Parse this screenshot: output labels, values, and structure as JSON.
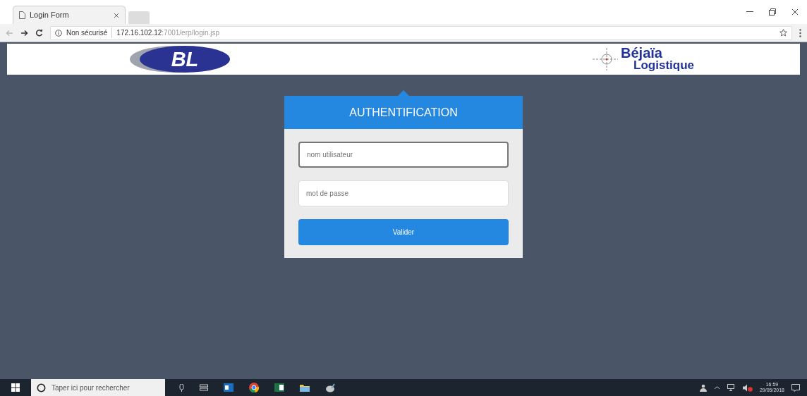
{
  "browser": {
    "tab_title": "Login Form",
    "security_label": "Non sécurisé",
    "url_host": "172.16.102.12",
    "url_path": ":7001/erp/login.jsp"
  },
  "header": {
    "left_logo": {
      "text": "BL"
    },
    "right_logo": {
      "line_1": "Béjaïa",
      "line_2": "Logistique"
    }
  },
  "login": {
    "title": "AUTHENTIFICATION",
    "fields": [
      {
        "placeholder": "nom utilisateur",
        "focused": true
      },
      {
        "placeholder": "mot de passe",
        "focused": false
      }
    ],
    "submit": "Valider"
  },
  "taskbar": {
    "search_placeholder": "Taper ici pour rechercher",
    "time": "16:59",
    "date": "29/05/2018"
  }
}
